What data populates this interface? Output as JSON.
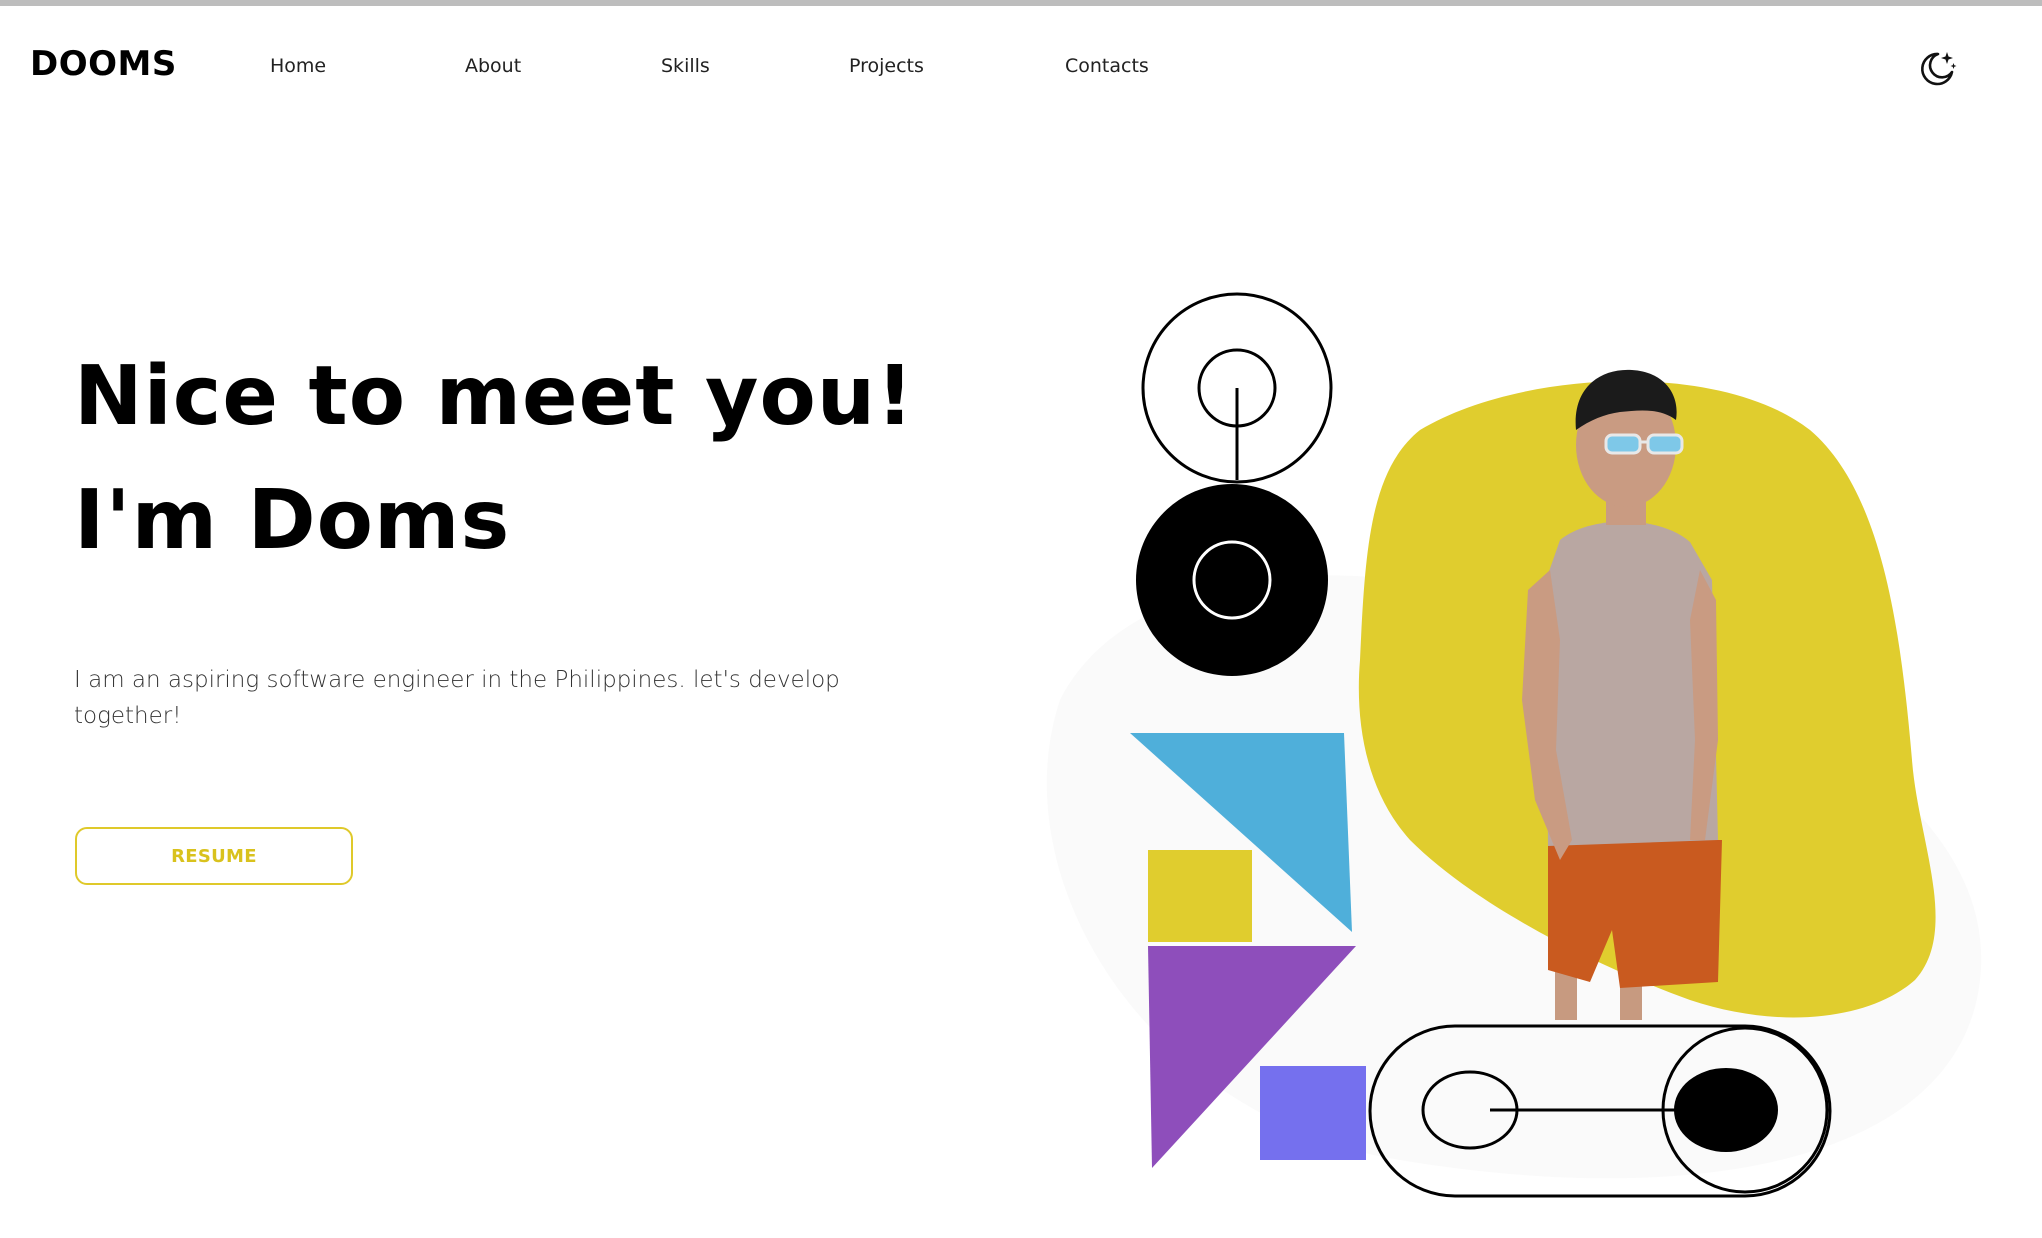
{
  "brand": {
    "logo_text": "DOOMS"
  },
  "nav": {
    "items": [
      {
        "label": "Home"
      },
      {
        "label": "About"
      },
      {
        "label": "Skills"
      },
      {
        "label": "Projects"
      },
      {
        "label": "Contacts"
      }
    ],
    "theme_toggle_icon": "moon-stars-icon"
  },
  "hero": {
    "title_line1": "Nice to meet you!",
    "title_line2": "I'm Doms",
    "description": "I am an aspiring software engineer in the Philippines. let's develop together!",
    "resume_label": "RESUME"
  },
  "colors": {
    "accent_yellow": "#E0CD2E",
    "blue_triangle": "#4FAFDA",
    "purple_triangle": "#8E4EBB",
    "violet_square": "#7570EE",
    "text_dark": "#000000"
  }
}
